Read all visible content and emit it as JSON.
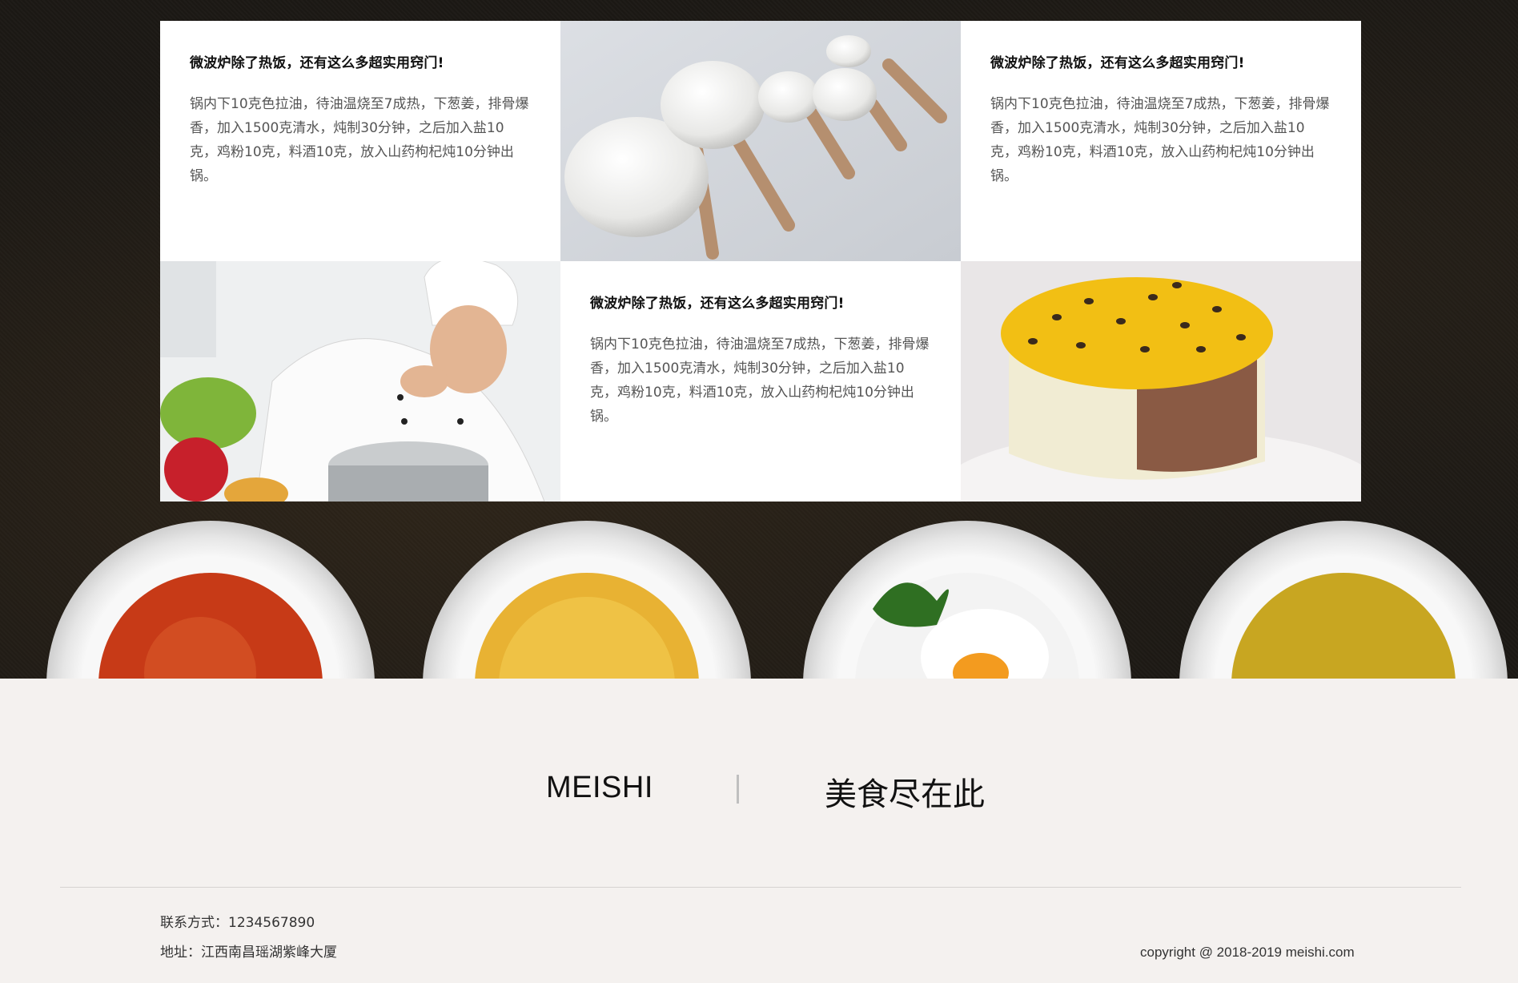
{
  "articles": [
    {
      "title": "微波炉除了热饭，还有这么多超实用窍门!",
      "body": "锅内下10克色拉油，待油温烧至7成热，下葱姜，排骨爆香，加入1500克清水，炖制30分钟，之后加入盐10克，鸡粉10克，料酒10克，放入山药枸杞炖10分钟出锅。"
    },
    {
      "title": "微波炉除了热饭，还有这么多超实用窍门!",
      "body": "锅内下10克色拉油，待油温烧至7成热，下葱姜，排骨爆香，加入1500克清水，炖制30分钟，之后加入盐10克，鸡粉10克，料酒10克，放入山药枸杞炖10分钟出锅。"
    },
    {
      "title": "微波炉除了热饭，还有这么多超实用窍门!",
      "body": "锅内下10克色拉油，待油温烧至7成热，下葱姜，排骨爆香，加入1500克清水，炖制30分钟，之后加入盐10克，鸡粉10克，料酒10克，放入山药枸杞炖10分钟出锅。"
    }
  ],
  "brand": {
    "en": "MEISHI",
    "cn": "美食尽在此"
  },
  "footer": {
    "contact": "联系方式：1234567890",
    "address": "地址：江西南昌瑶湖紫峰大厦",
    "copyright": "copyright @ 2018-2019 meishi.com"
  },
  "colors": {
    "dark_background": "#1c1915",
    "footer_background": "#f4f1ef",
    "card_background": "#ffffff"
  }
}
